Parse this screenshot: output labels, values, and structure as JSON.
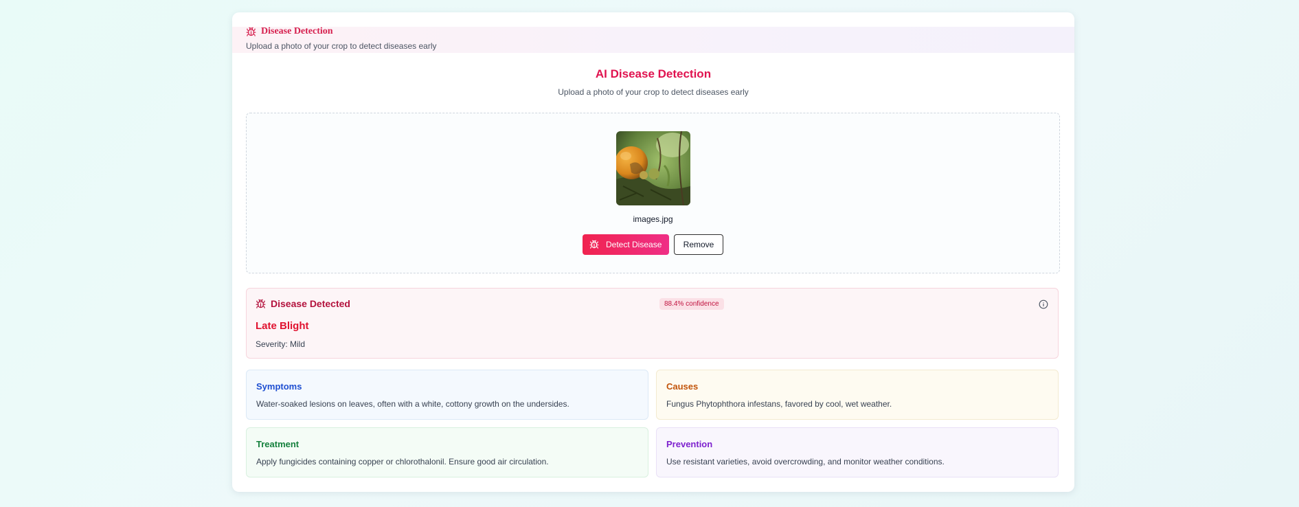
{
  "header": {
    "title": "Disease Detection",
    "subtitle": "Upload a photo of your crop to detect diseases early",
    "icon": "bug-icon"
  },
  "main": {
    "title": "AI Disease Detection",
    "subtitle": "Upload a photo of your crop to detect diseases early"
  },
  "upload": {
    "file_name": "images.jpg",
    "detect_label": "Detect Disease",
    "remove_label": "Remove"
  },
  "result": {
    "title": "Disease Detected",
    "confidence": "88.4% confidence",
    "disease_name": "Late Blight",
    "severity": "Severity: Mild"
  },
  "details": {
    "symptoms": {
      "title": "Symptoms",
      "text": "Water-soaked lesions on leaves, often with a white, cottony growth on the undersides."
    },
    "causes": {
      "title": "Causes",
      "text": "Fungus Phytophthora infestans, favored by cool, wet weather."
    },
    "treatment": {
      "title": "Treatment",
      "text": "Apply fungicides containing copper or chlorothalonil. Ensure good air circulation."
    },
    "prevention": {
      "title": "Prevention",
      "text": "Use resistant varieties, avoid overcrowding, and monitor weather conditions."
    }
  },
  "colors": {
    "accent": "#e0124f",
    "detect_button_start": "#f0234f",
    "detect_button_end": "#ef2f86"
  }
}
